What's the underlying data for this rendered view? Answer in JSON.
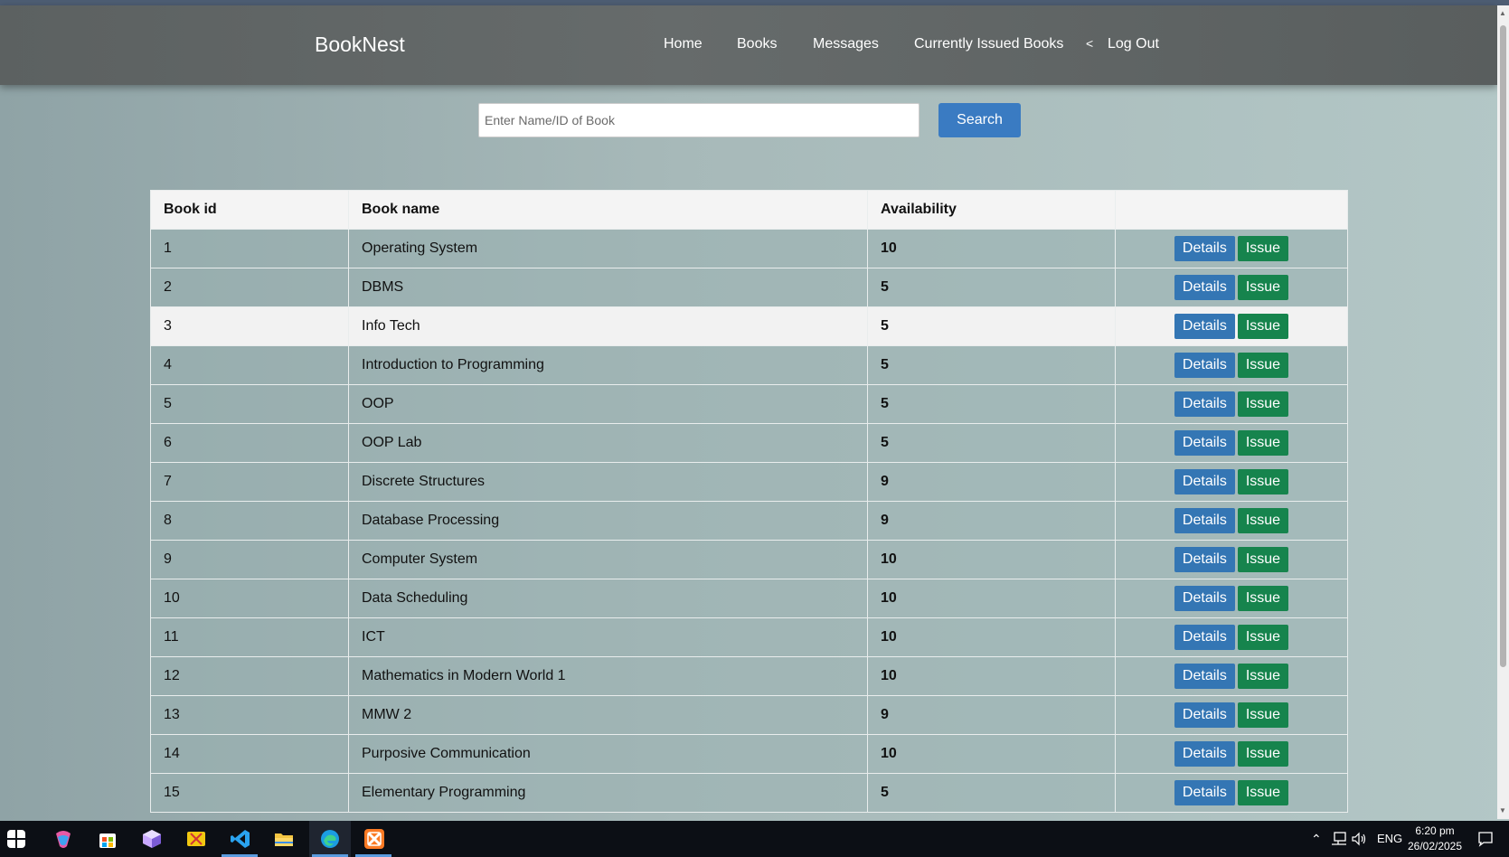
{
  "app": {
    "brand": "BookNest"
  },
  "nav": {
    "items": [
      "Home",
      "Books",
      "Messages",
      "Currently Issued Books"
    ],
    "separator": "<",
    "logout": "Log Out"
  },
  "search": {
    "placeholder": "Enter Name/ID of Book",
    "value": "",
    "button": "Search"
  },
  "table": {
    "headers": [
      "Book id",
      "Book name",
      "Availability",
      ""
    ],
    "rows": [
      {
        "id": "1",
        "name": "Operating System",
        "availability": "10"
      },
      {
        "id": "2",
        "name": "DBMS",
        "availability": "5"
      },
      {
        "id": "3",
        "name": "Info Tech",
        "availability": "5"
      },
      {
        "id": "4",
        "name": "Introduction to Programming",
        "availability": "5"
      },
      {
        "id": "5",
        "name": "OOP",
        "availability": "5"
      },
      {
        "id": "6",
        "name": "OOP Lab",
        "availability": "5"
      },
      {
        "id": "7",
        "name": "Discrete Structures",
        "availability": "9"
      },
      {
        "id": "8",
        "name": "Database Processing",
        "availability": "9"
      },
      {
        "id": "9",
        "name": "Computer System",
        "availability": "10"
      },
      {
        "id": "10",
        "name": "Data Scheduling",
        "availability": "10"
      },
      {
        "id": "11",
        "name": "ICT",
        "availability": "10"
      },
      {
        "id": "12",
        "name": "Mathematics in Modern World 1",
        "availability": "10"
      },
      {
        "id": "13",
        "name": "MMW 2",
        "availability": "9"
      },
      {
        "id": "14",
        "name": "Purposive Communication",
        "availability": "10"
      },
      {
        "id": "15",
        "name": "Elementary Programming",
        "availability": "5"
      }
    ],
    "details_label": "Details",
    "issue_label": "Issue",
    "highlighted_row": 3
  },
  "taskbar": {
    "icons": [
      "windows-start-icon",
      "copilot-icon",
      "microsoft-store-icon",
      "cube-app-icon",
      "snipping-tool-icon",
      "vscode-icon",
      "file-explorer-icon",
      "edge-icon",
      "xampp-icon"
    ],
    "active_app": "edge-icon",
    "language": "ENG",
    "time": "6:20 pm",
    "date": "26/02/2025"
  },
  "colors": {
    "nav_bg": "#5f6464",
    "page_bg": "#a7b9b9",
    "search_button": "#3a7bc2",
    "details_button": "#3476b4",
    "issue_button": "#16844d"
  }
}
